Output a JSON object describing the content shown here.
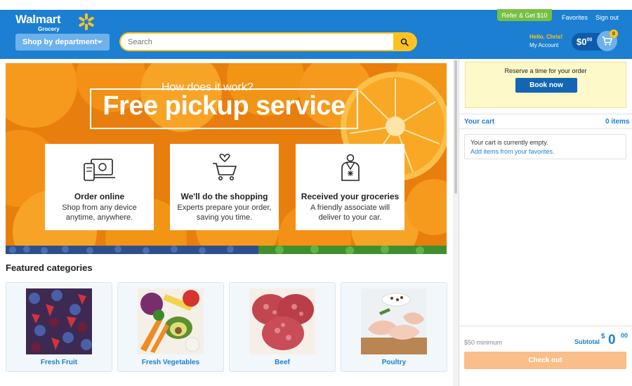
{
  "header": {
    "brand": "Walmart",
    "brand_sub": "Grocery",
    "shop_by_department": "Shop by department",
    "search_placeholder": "Search",
    "refer": "Refer & Get $10",
    "favorites": "Favorites",
    "sign_out": "Sign out",
    "greeting": "Hello, Chris!",
    "my_account": "My Account",
    "cart_dollars": "$0",
    "cart_cents": "00",
    "cart_badge": "0",
    "icons": [
      "spark-logo-icon",
      "chevron-down-icon",
      "search-icon",
      "cart-icon"
    ]
  },
  "hero": {
    "question": "How does it work?",
    "title": "Free pickup service",
    "cards": [
      {
        "title": "Order online",
        "desc": "Shop from any device anytime, anywhere.",
        "icon": "devices-icon"
      },
      {
        "title": "We'll do the shopping",
        "desc": "Experts prepare your order, saving you time.",
        "icon": "cart-heart-icon"
      },
      {
        "title": "Received your groceries",
        "desc": "A friendly associate will deliver to your car.",
        "icon": "associate-icon"
      }
    ]
  },
  "featured": {
    "title": "Featured categories",
    "categories": [
      {
        "label": "Fresh Fruit"
      },
      {
        "label": "Fresh Vegetables"
      },
      {
        "label": "Beef"
      },
      {
        "label": "Poultry"
      }
    ]
  },
  "sidebar": {
    "reserve_text": "Reserve a time for your order",
    "book_now": "Book now",
    "your_cart": "Your cart",
    "item_count": "0 items",
    "empty_text": "Your cart is currently empty.",
    "add_favorites": "Add items from your favorites.",
    "minimum": "$50 minimum",
    "subtotal_label": "Subtotal",
    "subtotal_dollar": "$",
    "subtotal_value": "0",
    "subtotal_cents": "00",
    "checkout": "Check out"
  },
  "colors": {
    "header_blue": "#1c7fd1",
    "accent_yellow": "#ffc220",
    "refer_green": "#76c043",
    "checkout_orange": "#f9be8a",
    "book_blue": "#1565b5"
  }
}
